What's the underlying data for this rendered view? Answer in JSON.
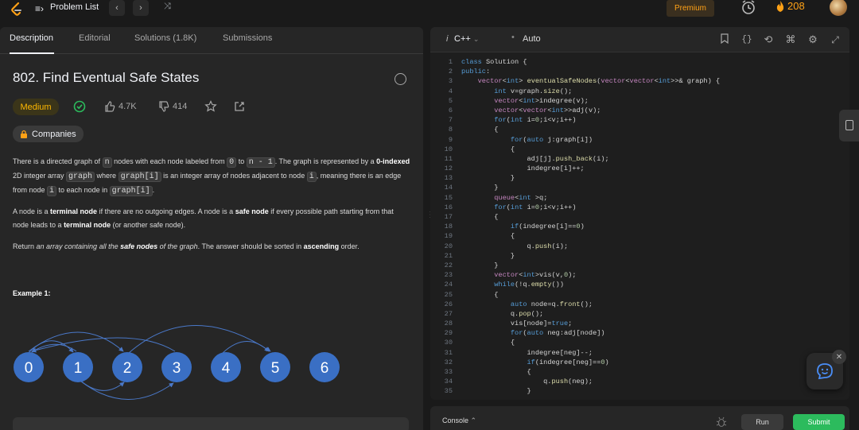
{
  "topbar": {
    "problem_list_label": "Problem List",
    "prev_label": "‹",
    "next_label": "›",
    "premium_label": "Premium",
    "streak_count": "208"
  },
  "tabs": [
    {
      "label": "Description",
      "active": true
    },
    {
      "label": "Editorial",
      "active": false
    },
    {
      "label": "Solutions (1.8K)",
      "active": false
    },
    {
      "label": "Submissions",
      "active": false
    }
  ],
  "problem": {
    "title": "802. Find Eventual Safe States",
    "difficulty": "Medium",
    "likes": "4.7K",
    "dislikes": "414",
    "companies_label": "Companies",
    "para1": {
      "t1": "There is a directed graph of ",
      "c1": "n",
      "t2": " nodes with each node labeled from ",
      "c2": "0",
      "t3": " to ",
      "c3": "n - 1",
      "t4": ". The graph is represented by a ",
      "b1": "0-indexed",
      "t5": " 2D integer array ",
      "c4": "graph",
      "t6": " where ",
      "c5": "graph[i]",
      "t7": " is an integer array of nodes adjacent to node ",
      "c6": "i",
      "t8": ", meaning there is an edge from node ",
      "c7": "i",
      "t9": " to each node in ",
      "c8": "graph[i]",
      "t10": "."
    },
    "para2": {
      "t1": "A node is a ",
      "b1": "terminal node",
      "t2": " if there are no outgoing edges. A node is a ",
      "b2": "safe node",
      "t3": " if every possible path starting from that node leads to a ",
      "b3": "terminal node",
      "t4": " (or another safe node)."
    },
    "para3": {
      "t1": "Return ",
      "i1": "an array containing all the ",
      "bi": "safe nodes",
      "i2": " of the graph",
      "t2": ". The answer should be sorted in ",
      "b1": "ascending",
      "t3": " order."
    },
    "example_title": "Example 1:",
    "graph_nodes": [
      "0",
      "1",
      "2",
      "3",
      "4",
      "5",
      "6"
    ],
    "graph_node_color": "#3a6fc4"
  },
  "editor": {
    "language": "C++",
    "autosave": "Auto",
    "code_lines": [
      "class Solution {",
      "public:",
      "    vector<int> eventualSafeNodes(vector<vector<int>>& graph) {",
      "        int v=graph.size();",
      "        vector<int>indegree(v);",
      "        vector<vector<int>>adj(v);",
      "        for(int i=0;i<v;i++)",
      "        {",
      "            for(auto j:graph[i])",
      "            {",
      "                adj[j].push_back(i);",
      "                indegree[i]++;",
      "            }",
      "        }",
      "        queue<int >q;",
      "        for(int i=0;i<v;i++)",
      "        {",
      "            if(indegree[i]==0)",
      "            {",
      "                q.push(i);",
      "            }",
      "        }",
      "        vector<int>vis(v,0);",
      "        while(!q.empty())",
      "        {",
      "            auto node=q.front();",
      "            q.pop();",
      "            vis[node]=true;",
      "            for(auto neg:adj[node])",
      "            {",
      "                indegree[neg]--;",
      "                if(indegree[neg]==0)",
      "                {",
      "                    q.push(neg);",
      "                }"
    ]
  },
  "console": {
    "label": "Console",
    "run_label": "Run",
    "submit_label": "Submit"
  },
  "colors": {
    "accent_orange": "#ffa116",
    "medium_yellow": "#ffb800",
    "submit_green": "#2cbb5d"
  }
}
